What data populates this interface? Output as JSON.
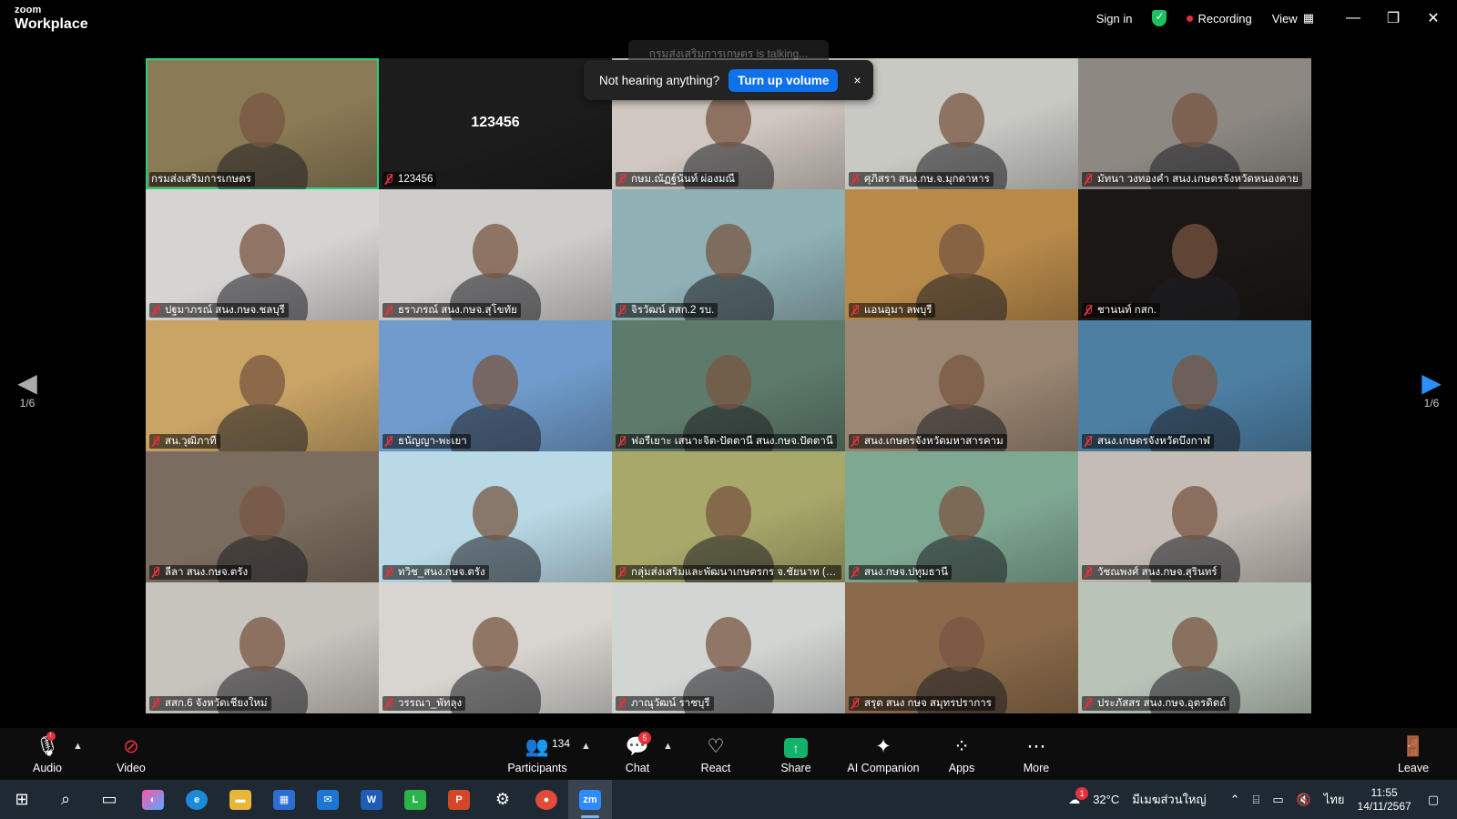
{
  "app": {
    "brand_small": "zoom",
    "brand_large": "Workplace"
  },
  "titlebar": {
    "sign_in": "Sign in",
    "recording": "Recording",
    "view": "View"
  },
  "talking_banner": "กรมส่งเสริมการเกษตร is talking...",
  "toast": {
    "message": "Not hearing anything?",
    "button": "Turn up volume",
    "close": "×"
  },
  "pagination": {
    "left": "1/6",
    "right": "1/6"
  },
  "tiles": [
    {
      "name": "กรมส่งเสริมการเกษตร",
      "active": true,
      "muted": false,
      "bg": "#8a7a55"
    },
    {
      "name": "123456",
      "big": "123456",
      "muted": true,
      "bg": "#1c1c1c"
    },
    {
      "name": "กษม.ณัฏฐ์นันท์ ผ่องมณี",
      "muted": true,
      "bg": "#cfc7c0"
    },
    {
      "name": "ศุภิสรา สนง.กษ.จ.มุกดาหาร",
      "muted": true,
      "bg": "#c9c9c4"
    },
    {
      "name": "มัทนา วงทองคำ สนง.เกษตรจังหวัดหนองคาย",
      "muted": true,
      "bg": "#8d8882"
    },
    {
      "name": "ปฐมาภรณ์ สนง.กษจ.ชลบุรี",
      "muted": true,
      "bg": "#d6d4d2"
    },
    {
      "name": "ธราภรณ์ สนง.กษจ.สุโขทัย",
      "muted": true,
      "bg": "#cfcdca"
    },
    {
      "name": "จิรวัฒน์ สสก.2 รบ.",
      "muted": true,
      "bg": "#8fb0b4"
    },
    {
      "name": "แอนอุมา ลพบุรี",
      "muted": true,
      "bg": "#b88a4a"
    },
    {
      "name": "ชานนท์ กสก.",
      "muted": true,
      "bg": "#1a1714"
    },
    {
      "name": "สน.วุฒิภาที",
      "muted": true,
      "bg": "#c9a465"
    },
    {
      "name": "ธนัญญา-พะเยา",
      "muted": true,
      "bg": "#6f9ccc"
    },
    {
      "name": "ฟอรีเยาะ เสนาะจิต-ปัตตานี สนง.กษจ.ปัตตานี",
      "muted": true,
      "bg": "#5d7a6a"
    },
    {
      "name": "สนง.เกษตรจังหวัดมหาสารคาม",
      "muted": true,
      "bg": "#9a8672"
    },
    {
      "name": "สนง.เกษตรจังหวัดบึงกาฬ",
      "muted": true,
      "bg": "#4d7fa3"
    },
    {
      "name": "ลีลา สนง.กษจ.ตรัง",
      "muted": true,
      "bg": "#7a6c5e"
    },
    {
      "name": "ทวิช_สนง.กษจ.ตรัง",
      "muted": true,
      "bg": "#b9d9e6"
    },
    {
      "name": "กลุ่มส่งเสริมและพัฒนาเกษตรกร จ.ชัยนาท (น...",
      "muted": true,
      "bg": "#a8a86a"
    },
    {
      "name": "สนง.กษจ.ปทุมธานี",
      "muted": true,
      "bg": "#7fa893"
    },
    {
      "name": "วัชณพงศ์ สนง.กษจ.สุรินทร์",
      "muted": true,
      "bg": "#c3bdb5"
    },
    {
      "name": "สสก.6 จังหวัดเชียงใหม่",
      "muted": true,
      "bg": "#c7c3bd"
    },
    {
      "name": "วรรณา_พัทลุง",
      "muted": true,
      "bg": "#d8d5d0"
    },
    {
      "name": "ภาณุวัฒน์ ราชบุรี",
      "muted": true,
      "bg": "#d2d6d3"
    },
    {
      "name": "สรุต สนง กษจ สมุทรปราการ",
      "muted": true,
      "bg": "#8a6a4a"
    },
    {
      "name": "ประภัสสร สนง.กษจ.อุตรดิตถ์",
      "muted": true,
      "bg": "#b9c4b9"
    }
  ],
  "toolbar": {
    "audio": "Audio",
    "video": "Video",
    "participants": "Participants",
    "participants_count": "134",
    "chat": "Chat",
    "chat_badge": "5",
    "react": "React",
    "share": "Share",
    "ai_companion": "AI Companion",
    "apps": "Apps",
    "more": "More",
    "leave": "Leave"
  },
  "taskbar": {
    "temperature": "32°C",
    "weather": "มีเมฆส่วนใหญ่",
    "language": "ไทย",
    "time": "11:55",
    "date": "14/11/2567",
    "weather_badge": "1"
  }
}
